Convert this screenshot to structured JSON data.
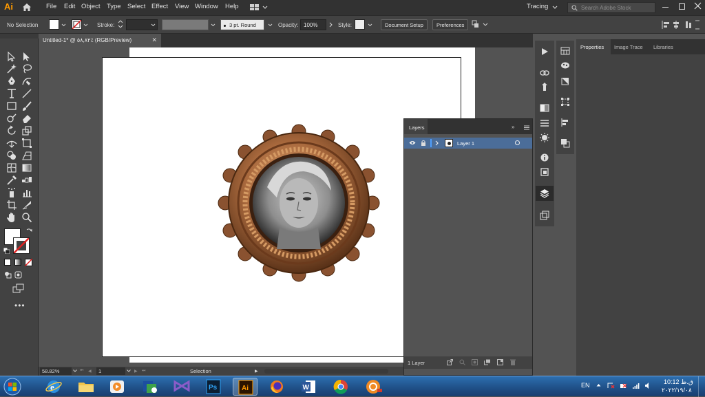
{
  "app": {
    "logo": "Ai"
  },
  "menu": [
    "File",
    "Edit",
    "Object",
    "Type",
    "Select",
    "Effect",
    "View",
    "Window",
    "Help"
  ],
  "workspace": "Tracing",
  "search": {
    "placeholder": "Search Adobe Stock"
  },
  "control": {
    "selection": "No Selection",
    "stroke_label": "Stroke:",
    "brush": "3 pt. Round",
    "opacity_label": "Opacity:",
    "opacity_value": "100%",
    "style_label": "Style:",
    "document_setup": "Document Setup",
    "preferences": "Preferences"
  },
  "document": {
    "tab_title": "Untitled-1* @ ٥٨,٨٢٪ (RGB/Preview)"
  },
  "status": {
    "zoom": "58.82%",
    "artboard": "1",
    "tool": "Selection"
  },
  "properties_panel": {
    "tabs": [
      "Properties",
      "Image Trace",
      "Libraries"
    ]
  },
  "layers_panel": {
    "title": "Layers",
    "layers": [
      {
        "name": "Layer 1"
      }
    ],
    "footer": "1 Layer"
  },
  "taskbar": {
    "language": "EN",
    "time": "10:12 ق.ظ",
    "date": "۲۰۲۲/۱۹/۰۸"
  },
  "colors": {
    "menubar": "#323232",
    "panel": "#424242",
    "canvas_bg": "#535353",
    "selection_highlight": "#4b6d99",
    "frame_bronze": "#a0633a"
  },
  "icons": {
    "home": "home-icon",
    "search": "search-icon",
    "layer_visibility": "eye-icon",
    "layer_lock": "lock-icon"
  }
}
